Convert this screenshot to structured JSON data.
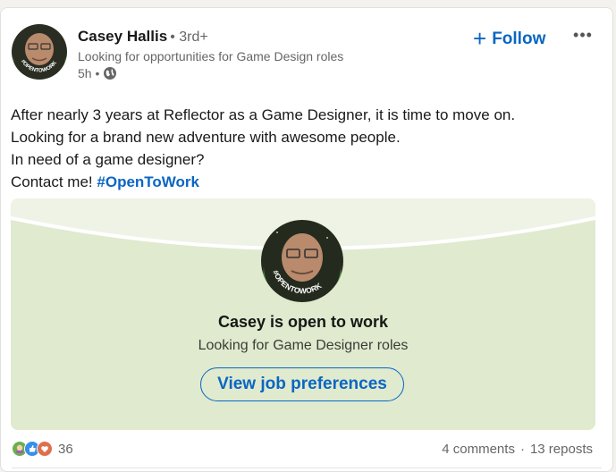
{
  "post": {
    "author": {
      "name": "Casey Hallis",
      "degree": "• 3rd+",
      "headline": "Looking for opportunities for Game Design roles",
      "time": "5h •",
      "badge_text": "#OPENTOWORK"
    },
    "actions": {
      "follow_label": "Follow",
      "follow_icon": "+",
      "more_icon": "•••"
    },
    "body": {
      "line1": "After nearly 3 years at Reflector as a Game Designer, it is time to move on.",
      "line2": "Looking for a brand new adventure with awesome people.",
      "line3": "In need of a game designer?",
      "line4_prefix": "Contact me!",
      "hashtag": "#OpenToWork"
    },
    "open_to_work": {
      "title": "Casey is open to work",
      "subtitle": "Looking for Game Designer roles",
      "button_label": "View job preferences"
    },
    "social": {
      "reaction_count": "36",
      "comments": "4 comments",
      "separator": "·",
      "reposts": "13 reposts"
    }
  },
  "colors": {
    "accent": "#0a66c2",
    "banner_bg": "#dfeacf",
    "opentowork_green": "#3f7a3a"
  }
}
